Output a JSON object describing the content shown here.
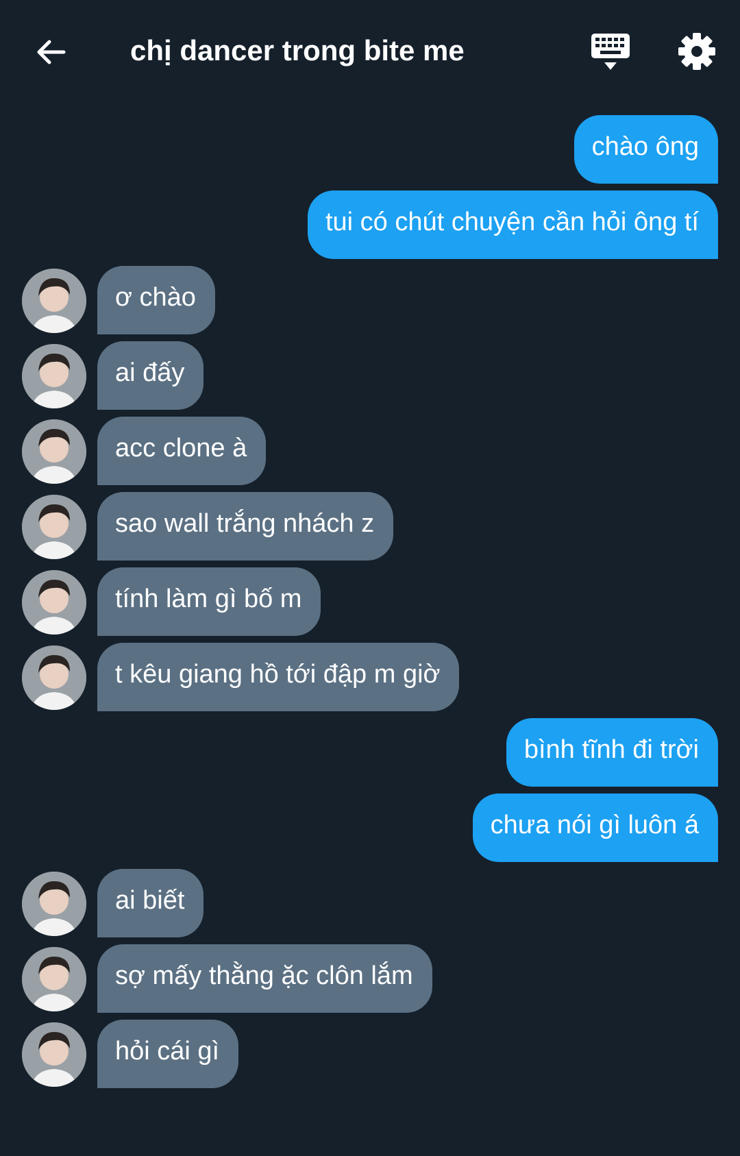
{
  "header": {
    "title": "chị dancer trong bite me",
    "back_icon": "arrow-left-icon",
    "keyboard_icon": "keyboard-icon",
    "settings_icon": "gear-icon"
  },
  "colors": {
    "background": "#15202b",
    "sent_bubble": "#1da1f2",
    "received_bubble": "#5b7083",
    "text": "#ffffff"
  },
  "messages": [
    {
      "direction": "sent",
      "text": "chào ông"
    },
    {
      "direction": "sent",
      "text": "tui có chút chuyện cần hỏi ông tí"
    },
    {
      "direction": "received",
      "text": "ơ chào"
    },
    {
      "direction": "received",
      "text": "ai đấy"
    },
    {
      "direction": "received",
      "text": "acc clone à"
    },
    {
      "direction": "received",
      "text": "sao wall trắng nhách z"
    },
    {
      "direction": "received",
      "text": "tính làm gì bố m"
    },
    {
      "direction": "received",
      "text": "t kêu giang hồ tới đập m giờ"
    },
    {
      "direction": "sent",
      "text": "bình tĩnh đi trời"
    },
    {
      "direction": "sent",
      "text": "chưa nói gì luôn á"
    },
    {
      "direction": "received",
      "text": "ai biết"
    },
    {
      "direction": "received",
      "text": "sợ mấy thằng ặc clôn lắm"
    },
    {
      "direction": "received",
      "text": "hỏi cái gì"
    }
  ]
}
